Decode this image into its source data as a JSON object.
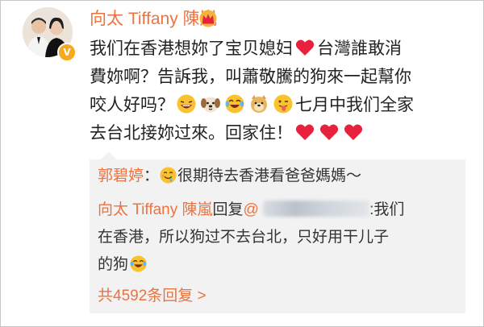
{
  "post": {
    "author": "向太 Tiffany 陳嵐",
    "verified_badge": "V",
    "lines": {
      "l1a": "我们在香港想妳了宝贝媳妇",
      "l1b": "台灣誰敢消",
      "l2": "費妳啊？告訴我，叫蕭敬騰的狗來一起幫你",
      "l3a": "咬人好吗？",
      "l3b": "七月中我们全家",
      "l4": "去台北接妳过來。回家住！"
    }
  },
  "replies": {
    "r1_author": "郭碧婷",
    "r1_colon": "：",
    "r1_text": "很期待去香港看爸爸媽媽～",
    "r2_author": "向太 Tiffany 陳嵐",
    "r2_reply_word": "回复",
    "r2_at": "@",
    "r2_text_a": ":我们",
    "r2_text_b": "在香港，所以狗过不去台北，只好用干儿子",
    "r2_text_c": "的狗",
    "more_label": "共4592条回复 >"
  },
  "icons": {
    "avatar": "avatar-image",
    "crown": "crown-icon",
    "heart": "red-heart-icon",
    "laugh": "laughing-emoji",
    "dog": "dog-face-emoji",
    "tears": "tears-of-joy-emoji",
    "doge": "doge-emoji",
    "tongue": "tongue-out-emoji",
    "drool": "drooling-emoji"
  },
  "colors": {
    "accent": "#eb7340",
    "heart": "#e8213d",
    "reply_bg": "#f2f2f2"
  }
}
